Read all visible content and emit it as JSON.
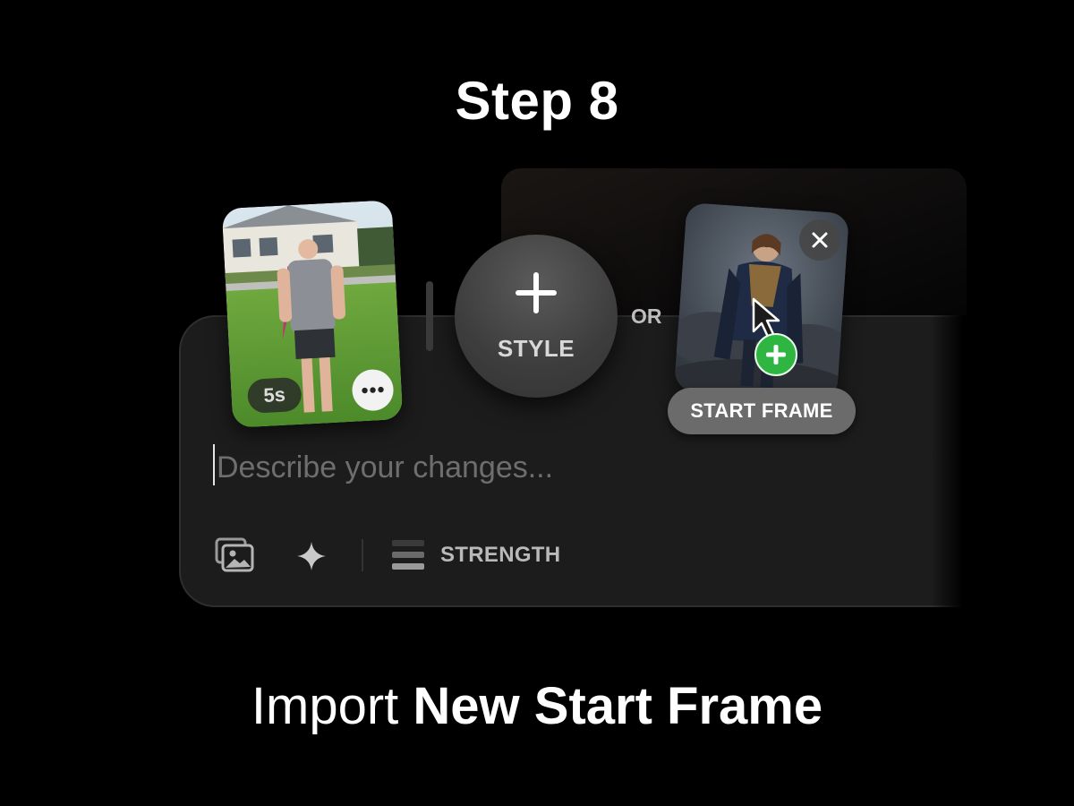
{
  "step_title": "Step 8",
  "caption": {
    "light": "Import",
    "bold": "New Start Frame"
  },
  "video_card": {
    "duration": "5s"
  },
  "style_button": {
    "label": "STYLE"
  },
  "or_label": "OR",
  "start_frame": {
    "label": "START FRAME"
  },
  "prompt": {
    "placeholder": "Describe your changes...",
    "value": ""
  },
  "toolbar": {
    "strength_label": "STRENGTH"
  },
  "colors": {
    "background": "#000000",
    "panel": "#1c1c1c",
    "add_badge": "#2fb541"
  },
  "icons": [
    "more-dots-icon",
    "plus-icon",
    "close-icon",
    "cursor-arrow-icon",
    "add-plus-icon",
    "image-gallery-icon",
    "sparkle-icon",
    "strength-bars-icon"
  ]
}
